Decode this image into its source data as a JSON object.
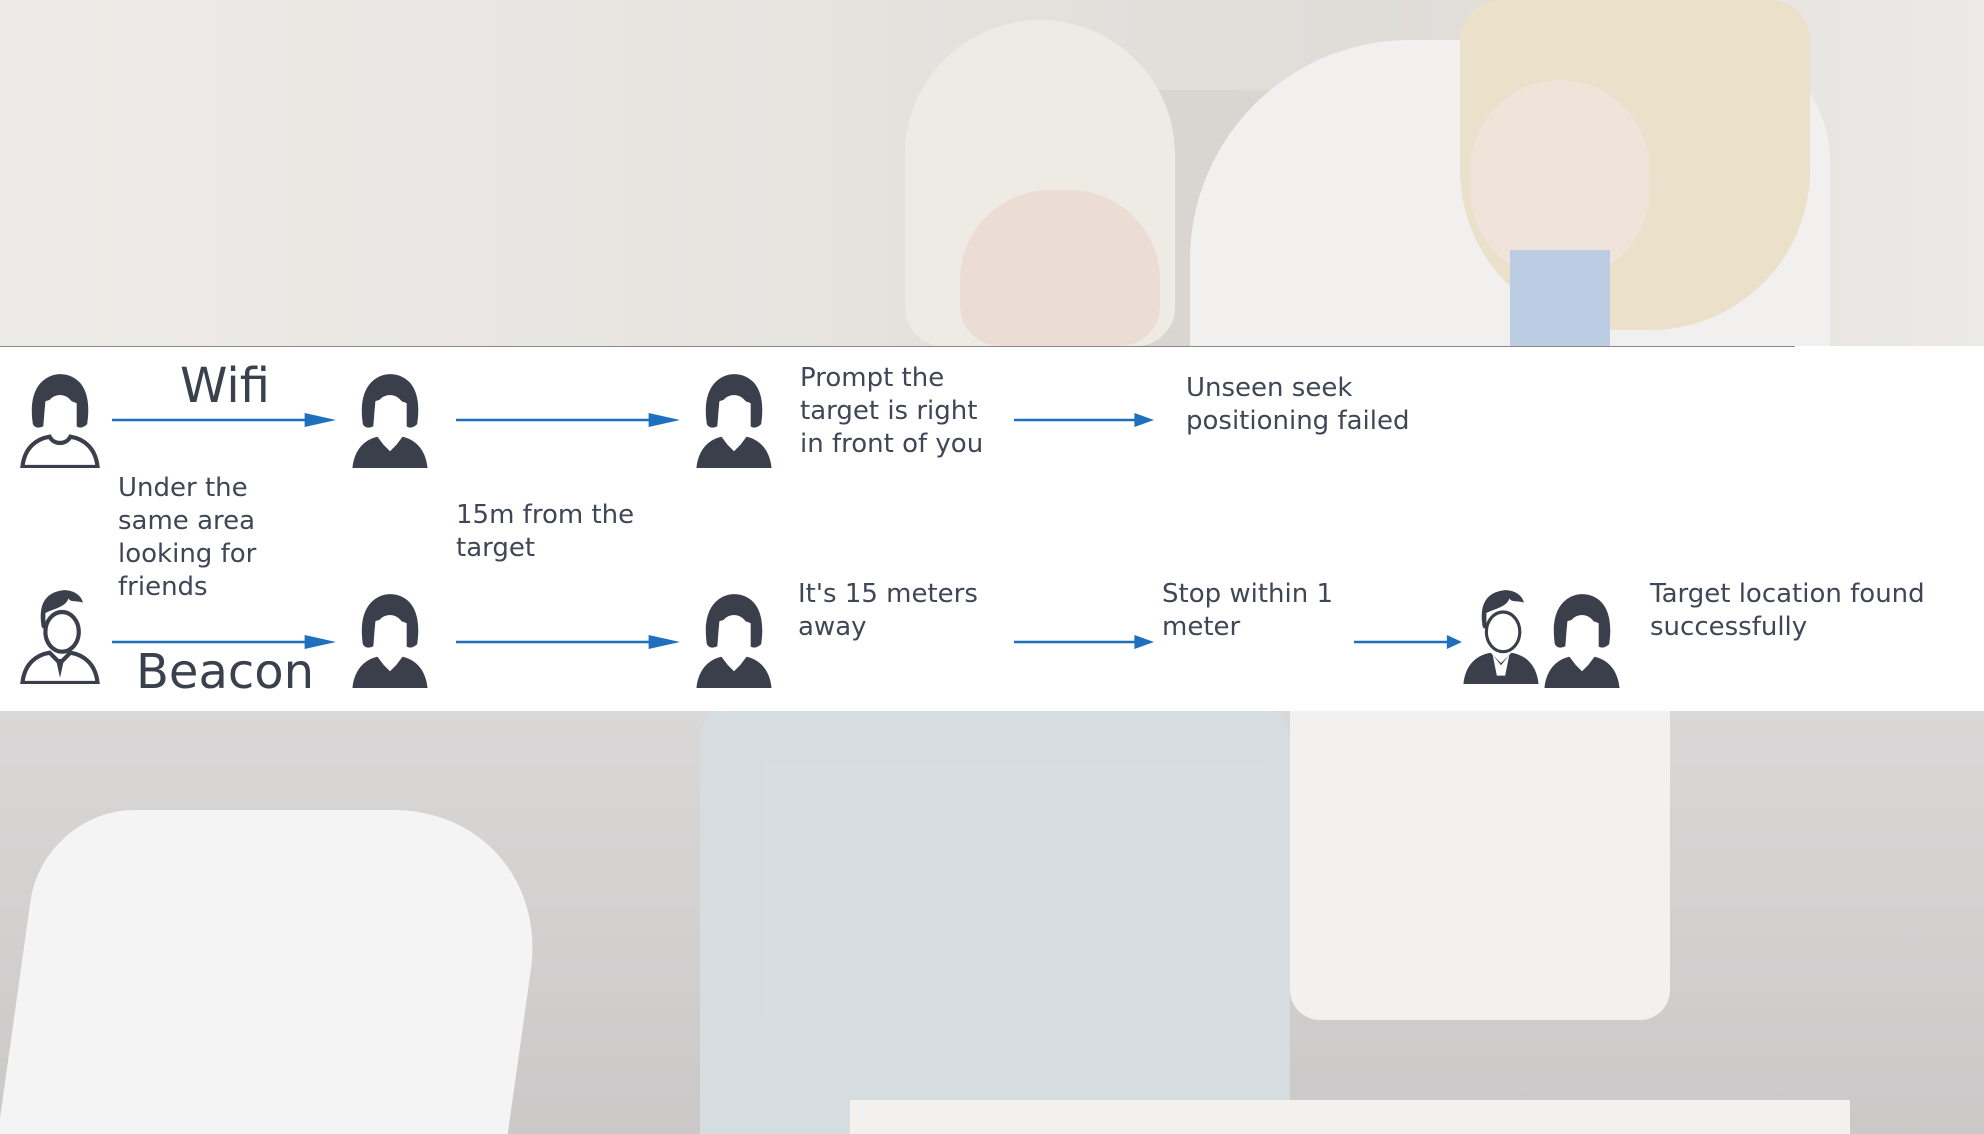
{
  "diagram": {
    "rows": [
      {
        "channel": "Wifi",
        "steps": [
          {
            "text": "Prompt the target is right in front of you"
          },
          {
            "text": "Unseen seek positioning failed"
          }
        ]
      },
      {
        "channel": "Beacon",
        "steps": [
          {
            "text": "It's 15 meters away"
          },
          {
            "text": "Stop within 1 meter"
          },
          {
            "text": "Target location found successfully"
          }
        ]
      }
    ],
    "notes": {
      "start": "Under the same area looking for friends",
      "distance": "15m from the target"
    }
  },
  "colors": {
    "accent": "#1f6fbf",
    "icon": "#3b3f4c",
    "text": "#3f4756",
    "band": "#ffffff"
  },
  "icons": [
    "woman-outline-icon",
    "woman-icon",
    "man-outline-icon",
    "man-woman-pair-icon",
    "arrow-right-icon"
  ]
}
